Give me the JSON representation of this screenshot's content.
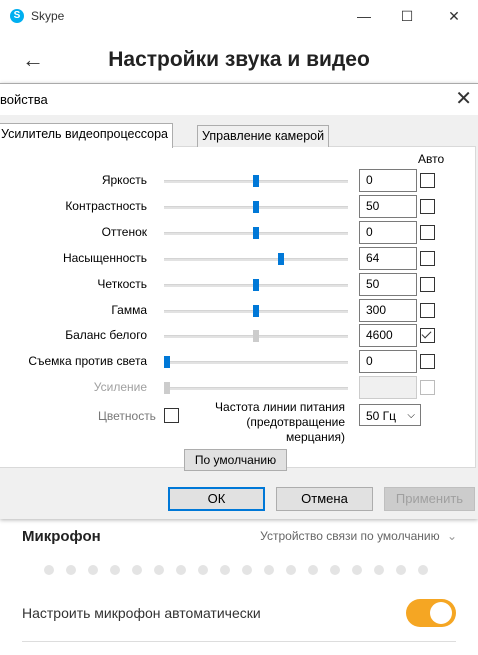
{
  "skype": {
    "app_title": "Skype",
    "logo_letter": "S",
    "window_controls": {
      "minimize": "—",
      "maximize": "☐",
      "close": "✕"
    },
    "back_glyph": "←",
    "heading": "Настройки звука и видео",
    "microphone": {
      "title": "Микрофон",
      "device": "Устройство связи по умолчанию",
      "auto_label": "Настроить микрофон автоматически",
      "auto_enabled": true,
      "toggle_color": "#f5a623",
      "level_dots": 18
    }
  },
  "dialog": {
    "title": "войства",
    "close_glyph": "✕",
    "tabs": [
      {
        "label": "Усилитель видеопроцессора",
        "active": true
      },
      {
        "label": "Управление камерой",
        "active": false
      }
    ],
    "auto_header": "Авто",
    "rows": [
      {
        "label": "Яркость",
        "value": "0",
        "level": 0.5,
        "auto": false,
        "disabled": false
      },
      {
        "label": "Контрастность",
        "value": "50",
        "level": 0.5,
        "auto": false,
        "disabled": false
      },
      {
        "label": "Оттенок",
        "value": "0",
        "level": 0.5,
        "auto": false,
        "disabled": false
      },
      {
        "label": "Насыщенность",
        "value": "64",
        "level": 0.64,
        "auto": false,
        "disabled": false
      },
      {
        "label": "Четкость",
        "value": "50",
        "level": 0.5,
        "auto": false,
        "disabled": false
      },
      {
        "label": "Гамма",
        "value": "300",
        "level": 0.5,
        "auto": false,
        "disabled": false
      },
      {
        "label": "Баланс белого",
        "value": "4600",
        "level": 0.5,
        "auto": true,
        "disabled": false,
        "slider_disabled": true
      },
      {
        "label": "Съемка против света",
        "value": "0",
        "level": 0.0,
        "auto": false,
        "disabled": false
      },
      {
        "label": "Усиление",
        "value": "",
        "level": 0.0,
        "auto": false,
        "disabled": true
      }
    ],
    "color_label": "Цветность",
    "freq_label_lines": [
      "Частота линии питания",
      "(предотвращение",
      "мерцания)"
    ],
    "freq_value": "50 Гц",
    "freq_arrow": "⌵",
    "default_button": "По умолчанию",
    "ok": "ОК",
    "cancel": "Отмена",
    "apply": "Применить",
    "accent_color": "#0078d7"
  }
}
